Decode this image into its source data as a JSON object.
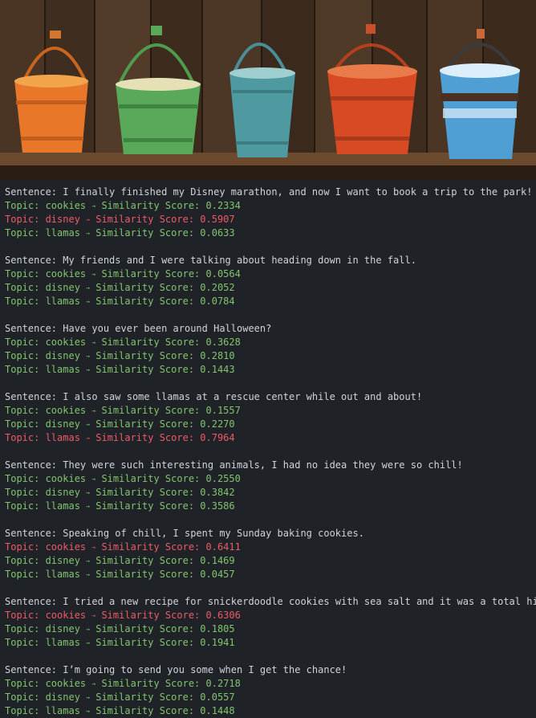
{
  "banner": {
    "image_name": "buckets-illustration",
    "bucket_colors": [
      "#e8772a",
      "#5aa85a",
      "#4e9aa0",
      "#d84a23",
      "#4f9fd4"
    ]
  },
  "console": {
    "sentence_prefix": "Sentence: ",
    "topic_prefix": "Topic: ",
    "arrow_glyph": "→",
    "score_prefix": " Similarity Score: ",
    "colors": {
      "text": "#d0d4d9",
      "normal": "#82c46e",
      "highlight": "#ee5a66",
      "background": "#1f2328"
    },
    "blocks": [
      {
        "sentence": "I finally finished my Disney marathon, and now I want to book a trip to the park!",
        "topics": [
          {
            "topic": "cookies",
            "score": "0.2334",
            "highlight": false
          },
          {
            "topic": "disney",
            "score": "0.5907",
            "highlight": true
          },
          {
            "topic": "llamas",
            "score": "0.0633",
            "highlight": false
          }
        ]
      },
      {
        "sentence": "My friends and I were talking about heading down in the fall.",
        "topics": [
          {
            "topic": "cookies",
            "score": "0.0564",
            "highlight": false
          },
          {
            "topic": "disney",
            "score": "0.2052",
            "highlight": false
          },
          {
            "topic": "llamas",
            "score": "0.0784",
            "highlight": false
          }
        ]
      },
      {
        "sentence": "Have you ever been around Halloween?",
        "topics": [
          {
            "topic": "cookies",
            "score": "0.3628",
            "highlight": false
          },
          {
            "topic": "disney",
            "score": "0.2810",
            "highlight": false
          },
          {
            "topic": "llamas",
            "score": "0.1443",
            "highlight": false
          }
        ]
      },
      {
        "sentence": "I also saw some llamas at a rescue center while out and about!",
        "topics": [
          {
            "topic": "cookies",
            "score": "0.1557",
            "highlight": false
          },
          {
            "topic": "disney",
            "score": "0.2270",
            "highlight": false
          },
          {
            "topic": "llamas",
            "score": "0.7964",
            "highlight": true
          }
        ]
      },
      {
        "sentence": "They were such interesting animals, I had no idea they were so chill!",
        "topics": [
          {
            "topic": "cookies",
            "score": "0.2550",
            "highlight": false
          },
          {
            "topic": "disney",
            "score": "0.3842",
            "highlight": false
          },
          {
            "topic": "llamas",
            "score": "0.3586",
            "highlight": false
          }
        ]
      },
      {
        "sentence": "Speaking of chill, I spent my Sunday baking cookies.",
        "topics": [
          {
            "topic": "cookies",
            "score": "0.6411",
            "highlight": true
          },
          {
            "topic": "disney",
            "score": "0.1469",
            "highlight": false
          },
          {
            "topic": "llamas",
            "score": "0.0457",
            "highlight": false
          }
        ]
      },
      {
        "sentence": "I tried a new recipe for snickerdoodle cookies with sea salt and it was a total hit.",
        "topics": [
          {
            "topic": "cookies",
            "score": "0.6306",
            "highlight": true
          },
          {
            "topic": "disney",
            "score": "0.1805",
            "highlight": false
          },
          {
            "topic": "llamas",
            "score": "0.1941",
            "highlight": false
          }
        ]
      },
      {
        "sentence": "I’m going to send you some when I get the chance!",
        "topics": [
          {
            "topic": "cookies",
            "score": "0.2718",
            "highlight": false
          },
          {
            "topic": "disney",
            "score": "0.0557",
            "highlight": false
          },
          {
            "topic": "llamas",
            "score": "0.1448",
            "highlight": false
          }
        ]
      }
    ]
  }
}
